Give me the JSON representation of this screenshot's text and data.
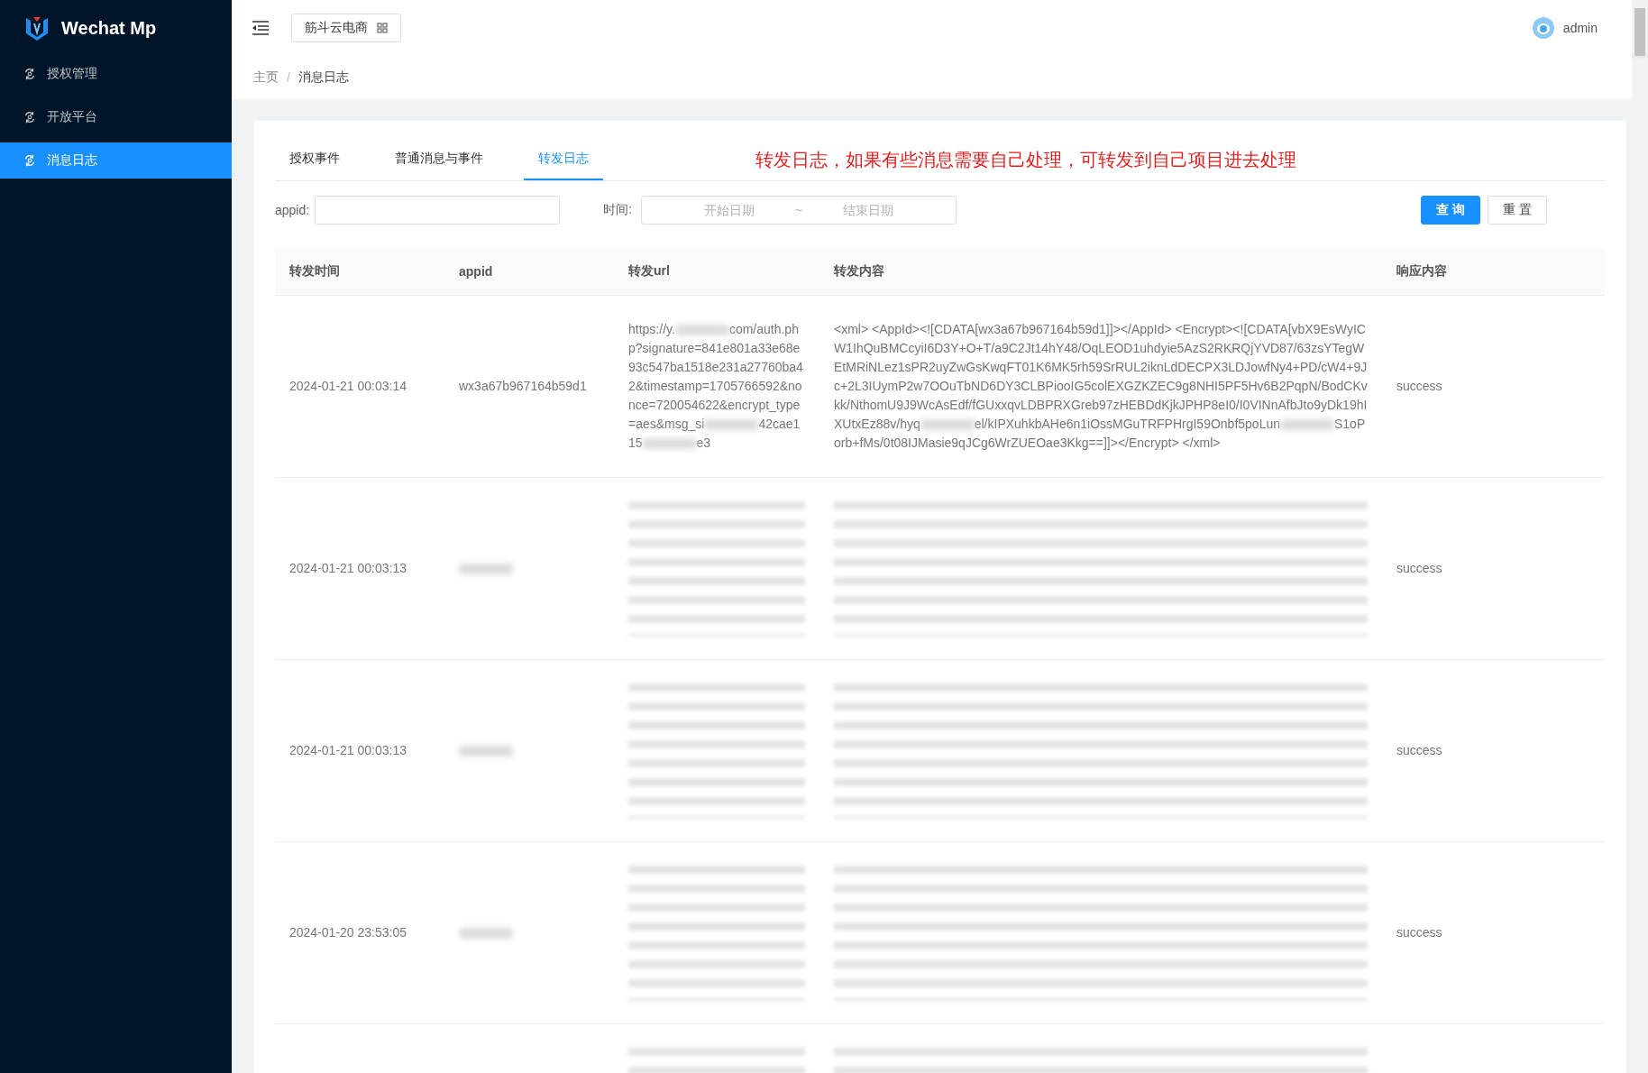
{
  "sidebar": {
    "logo_text": "Wechat Mp",
    "items": [
      {
        "label": "授权管理",
        "selected": false
      },
      {
        "label": "开放平台",
        "selected": false
      },
      {
        "label": "消息日志",
        "selected": true
      }
    ]
  },
  "header": {
    "tenant": "筋斗云电商",
    "user": "admin"
  },
  "breadcrumb": {
    "items": [
      "主页",
      "消息日志"
    ],
    "separator": "/"
  },
  "tabs": [
    {
      "label": "授权事件",
      "selected": false
    },
    {
      "label": "普通消息与事件",
      "selected": false
    },
    {
      "label": "转发日志",
      "selected": true
    }
  ],
  "annotation": "转发日志，如果有些消息需要自己处理，可转发到自己项目进去处理",
  "filters": {
    "appid_label": "appid:",
    "time_label": "时间:",
    "start_placeholder": "开始日期",
    "separator": "~",
    "end_placeholder": "结束日期",
    "query_button": "查 询",
    "reset_button": "重 置"
  },
  "table": {
    "columns": [
      "转发时间",
      "appid",
      "转发url",
      "转发内容",
      "响应内容"
    ],
    "rows": [
      {
        "time": "2024-01-21 00:03:14",
        "appid": [
          {
            "kind": "text",
            "text": "wx3a67b967164b59d1"
          }
        ],
        "url": [
          {
            "kind": "text",
            "text": "https://y."
          },
          {
            "kind": "blur"
          },
          {
            "kind": "text",
            "text": "com/auth.php?signature=841e801a33e68e93c547ba1518e231a27760ba42&timestamp=1705766592&nonce=720054622&encrypt_type=aes&msg_si"
          },
          {
            "kind": "blur"
          },
          {
            "kind": "text",
            "text": "42cae115"
          },
          {
            "kind": "blur"
          },
          {
            "kind": "text",
            "text": "e3"
          }
        ],
        "content": [
          {
            "kind": "text",
            "text": "<xml> <AppId><![CDATA[wx3a67b967164b59d1]]></AppId> <Encrypt><![CDATA[vbX9EsWyICW1IhQuBMCcyiI6D3Y+O+T/a9C2Jt14hY48/OqLEOD1uhdyie5AzS2RKRQjYVD87/63zsYTegWEtMRiNLez1sPR2uyZwGsKwqFT01K6MK5rh59SrRUL2iknLdDECPX3LDJowfNy4+PD/cW4+9Jc+2L3IUymP2w7OOuTbND6DY3CLBPiooIG5colEXGZKZEC9g8NHI5PF5Hv6B2PqpN/BodCKvkk/NthomU9J9WcAsEdf/fGUxxqvLDBPRXGreb97zHEBDdKjkJPHP8eI0/I0VINnAfbJto9yDk19hIXUtxEz88v/hyq"
          },
          {
            "kind": "blur"
          },
          {
            "kind": "text",
            "text": "el/kIPXuhkbAHe6n1iOssMGuTRFPHrgI59Onbf5poLun"
          },
          {
            "kind": "blur"
          },
          {
            "kind": "text",
            "text": "S1oPorb+fMs/0t08IJMasie9qJCg6WrZUEOae3Kkg==]]></Encrypt> </xml>"
          }
        ],
        "response": "success"
      },
      {
        "time": "2024-01-21 00:03:13",
        "appid": [
          {
            "kind": "blur"
          }
        ],
        "url": [
          {
            "kind": "blur_block"
          }
        ],
        "content": [
          {
            "kind": "blur_block"
          }
        ],
        "response": "success"
      },
      {
        "time": "2024-01-21 00:03:13",
        "appid": [
          {
            "kind": "blur"
          }
        ],
        "url": [
          {
            "kind": "blur_block"
          }
        ],
        "content": [
          {
            "kind": "blur_block"
          }
        ],
        "response": "success"
      },
      {
        "time": "2024-01-20 23:53:05",
        "appid": [
          {
            "kind": "blur"
          }
        ],
        "url": [
          {
            "kind": "blur_block"
          }
        ],
        "content": [
          {
            "kind": "blur_block"
          }
        ],
        "response": "success"
      },
      {
        "url": [
          {
            "kind": "blur_block"
          }
        ],
        "content": [
          {
            "kind": "blur_block"
          }
        ]
      }
    ]
  }
}
